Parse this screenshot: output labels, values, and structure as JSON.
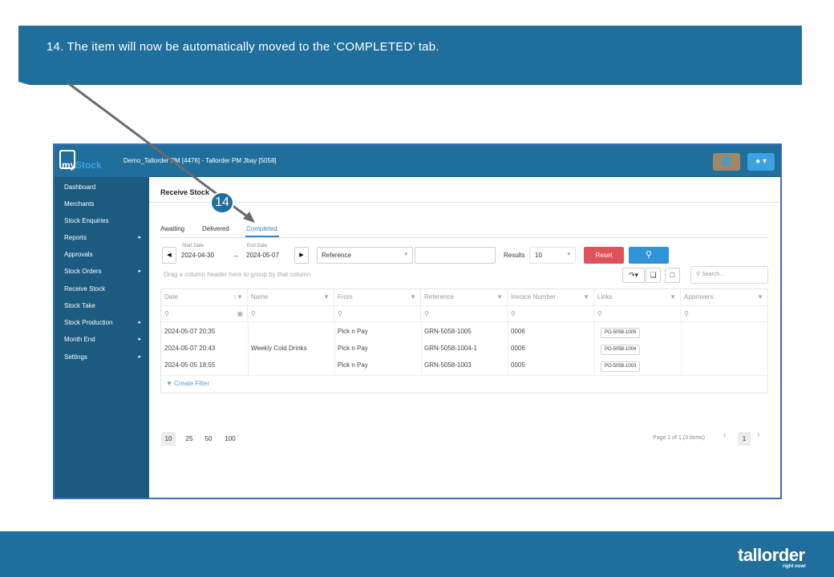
{
  "instruction": "14. The item will now be automatically moved to the ‘COMPLETED’ tab.",
  "step_number": "14",
  "app": {
    "brand_my": "my",
    "brand_stock": "Stock",
    "company": "Demo_Tallorder PM [4476] - Tallorder PM Jbay [5058]"
  },
  "sidebar": {
    "items": [
      {
        "label": "Dashboard",
        "has_children": false
      },
      {
        "label": "Merchants",
        "has_children": false
      },
      {
        "label": "Stock Enquiries",
        "has_children": false
      },
      {
        "label": "Reports",
        "has_children": true
      },
      {
        "label": "Approvals",
        "has_children": false
      },
      {
        "label": "Stock Orders",
        "has_children": true
      },
      {
        "label": "Receive Stock",
        "has_children": false
      },
      {
        "label": "Stock Take",
        "has_children": false
      },
      {
        "label": "Stock Production",
        "has_children": true
      },
      {
        "label": "Month End",
        "has_children": true
      },
      {
        "label": "Settings",
        "has_children": true
      }
    ]
  },
  "page_title": "Receive Stock",
  "tabs": [
    "Awaiting",
    "Delivered",
    "Completed"
  ],
  "active_tab": "Completed",
  "filters": {
    "start_date_label": "Start Date",
    "start_date": "2024-04-30",
    "end_date_label": "End Date",
    "end_date": "2024-05-07",
    "arrow": "→",
    "search_field": "Reference",
    "search_value": "",
    "results_label": "Results",
    "results_value": "10",
    "reset_label": "Reset"
  },
  "toolbar": {
    "group_hint": "Drag a column header here to group by that column",
    "search_placeholder": "Search..."
  },
  "table": {
    "columns": [
      "Date",
      "Name",
      "From",
      "Reference",
      "Invoice Number",
      "Links",
      "Approvers"
    ],
    "rows": [
      {
        "date": "2024-05-07 20:35",
        "name": "",
        "from": "Pick n Pay",
        "reference": "GRN-5058-1005",
        "invoice": "0006",
        "link": "PO-5058-1005",
        "approvers": ""
      },
      {
        "date": "2024-05-07 20:43",
        "name": "Weekly Cold Drinks",
        "from": "Pick n Pay",
        "reference": "GRN-5058-1004-1",
        "invoice": "0006",
        "link": "PO-5058-1004",
        "approvers": ""
      },
      {
        "date": "2024-05-05 18:55",
        "name": "",
        "from": "Pick n Pay",
        "reference": "GRN-5058-1003",
        "invoice": "0005",
        "link": "PO-5058-1003",
        "approvers": ""
      }
    ],
    "create_filter": "Create Filter"
  },
  "pager": {
    "sizes": [
      "10",
      "25",
      "50",
      "100"
    ],
    "active_size": "10",
    "info": "Page 1 of 1 (3 items)",
    "current_page": "1"
  },
  "footer_logo": {
    "main": "tallorder",
    "sub": "right now!"
  },
  "colors": {
    "brand_blue": "#1f6e9c",
    "sidebar": "#1c5a80",
    "accent_blue": "#2f93d8",
    "reset_red": "#e0525a",
    "globe_btn": "#a08768"
  }
}
